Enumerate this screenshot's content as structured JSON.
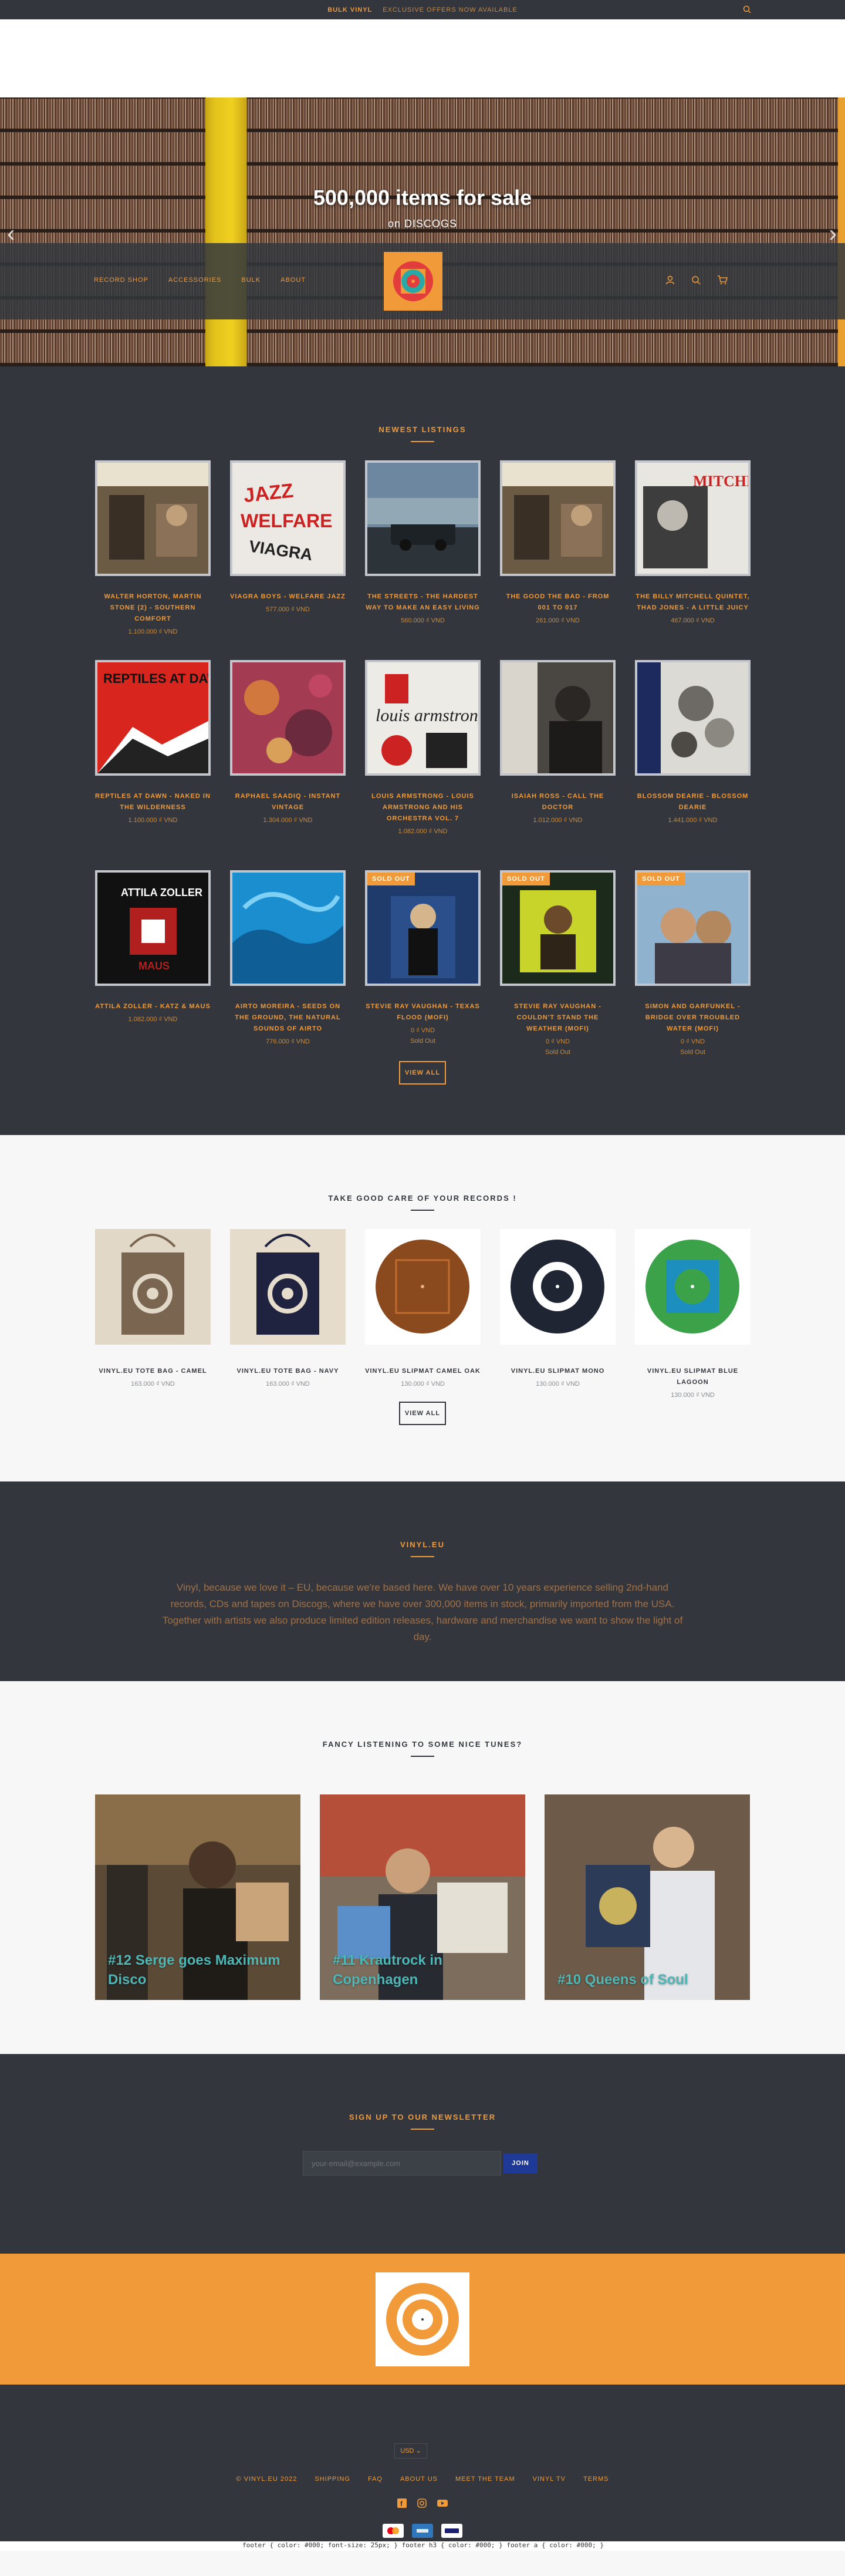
{
  "announcement": {
    "bold": "BULK VINYL",
    "text": "EXCLUSIVE OFFERS NOW AVAILABLE"
  },
  "hero": {
    "title": "500,000 items for sale",
    "subtitle": "on DISCOGS"
  },
  "nav": {
    "items": [
      "RECORD SHOP",
      "ACCESSORIES",
      "BULK",
      "ABOUT"
    ]
  },
  "listings": {
    "title": "NEWEST LISTINGS",
    "rows": [
      [
        {
          "title": "WALTER HORTON, MARTIN STONE (2) - SOUTHERN COMFORT",
          "price": "1.100.000 ₫ VND",
          "status": ""
        },
        {
          "title": "VIAGRA BOYS - WELFARE JAZZ",
          "price": "577.000 ₫ VND",
          "status": ""
        },
        {
          "title": "THE STREETS - THE HARDEST WAY TO MAKE AN EASY LIVING",
          "price": "560.000 ₫ VND",
          "status": ""
        },
        {
          "title": "THE GOOD THE BAD - FROM 001 TO 017",
          "price": "261.000 ₫ VND",
          "status": ""
        },
        {
          "title": "THE BILLY MITCHELL QUINTET, THAD JONES - A LITTLE JUICY",
          "price": "467.000 ₫ VND",
          "status": ""
        }
      ],
      [
        {
          "title": "REPTILES AT DAWN - NAKED IN THE WILDERNESS",
          "price": "1.100.000 ₫ VND",
          "status": ""
        },
        {
          "title": "RAPHAEL SAADIQ - INSTANT VINTAGE",
          "price": "1.304.000 ₫ VND",
          "status": ""
        },
        {
          "title": "LOUIS ARMSTRONG - LOUIS ARMSTRONG AND HIS ORCHESTRA VOL. 7",
          "price": "1.082.000 ₫ VND",
          "status": ""
        },
        {
          "title": "ISAIAH ROSS - CALL THE DOCTOR",
          "price": "1.012.000 ₫ VND",
          "status": ""
        },
        {
          "title": "BLOSSOM DEARIE - BLOSSOM DEARIE",
          "price": "1.441.000 ₫ VND",
          "status": ""
        }
      ],
      [
        {
          "title": "ATTILA ZOLLER - KATZ & MAUS",
          "price": "1.082.000 ₫ VND",
          "status": "",
          "badge": ""
        },
        {
          "title": "AIRTO MOREIRA - SEEDS ON THE GROUND, THE NATURAL SOUNDS OF AIRTO",
          "price": "776.000 ₫ VND",
          "status": "",
          "badge": ""
        },
        {
          "title": "STEVIE RAY VAUGHAN - TEXAS FLOOD (MOFI)",
          "price": "0 ₫ VND",
          "status": "Sold Out",
          "badge": "SOLD OUT"
        },
        {
          "title": "STEVIE RAY VAUGHAN - COULDN'T STAND THE WEATHER (MOFI)",
          "price": "0 ₫ VND",
          "status": "Sold Out",
          "badge": "SOLD OUT"
        },
        {
          "title": "SIMON AND GARFUNKEL - BRIDGE OVER TROUBLED WATER (MOFI)",
          "price": "0 ₫ VND",
          "status": "Sold Out",
          "badge": "SOLD OUT"
        }
      ]
    ],
    "view_all": "VIEW ALL"
  },
  "care": {
    "title": "TAKE GOOD CARE OF YOUR RECORDS !",
    "items": [
      {
        "title": "VINYL.EU TOTE BAG - CAMEL",
        "price": "163.000 ₫ VND"
      },
      {
        "title": "VINYL.EU TOTE BAG - NAVY",
        "price": "163.000 ₫ VND"
      },
      {
        "title": "VINYL.EU SLIPMAT CAMEL OAK",
        "price": "130.000 ₫ VND"
      },
      {
        "title": "VINYL.EU SLIPMAT MONO",
        "price": "130.000 ₫ VND"
      },
      {
        "title": "VINYL.EU SLIPMAT BLUE LAGOON",
        "price": "130.000 ₫ VND"
      }
    ],
    "view_all": "VIEW ALL"
  },
  "about": {
    "title": "VINYL.EU",
    "text": "Vinyl, because we love it – EU, because we're based here. We have over 10 years experience selling 2nd-hand records, CDs and tapes on Discogs, where we have over 300,000 items in stock, primarily imported from the USA. Together with artists we also produce limited edition releases, hardware and merchandise we want to show the light of day."
  },
  "tunes": {
    "title": "FANCY LISTENING TO SOME NICE TUNES?",
    "tiles": [
      "#12 Serge goes Maximum Disco",
      "#11 Krautrock in Copenhagen",
      "#10 Queens of Soul"
    ]
  },
  "newsletter": {
    "title": "SIGN UP TO OUR NEWSLETTER",
    "placeholder": "your-email@example.com",
    "button": "JOIN"
  },
  "footer": {
    "currency": "USD ⌄",
    "links": [
      "© VINYL.EU 2022",
      "SHIPPING",
      "FAQ",
      "ABOUT US",
      "MEET THE TEAM",
      "VINYL TV",
      "TERMS"
    ],
    "payments": [
      "mastercard",
      "amex",
      "visa"
    ]
  },
  "debug_text": "footer { color: #000; font-size: 25px; } footer h3 { color: #000; } footer a { color: #000; }",
  "colors": {
    "dark": "#33373d",
    "accent": "#f19a39",
    "light": "#f7f7f7"
  }
}
